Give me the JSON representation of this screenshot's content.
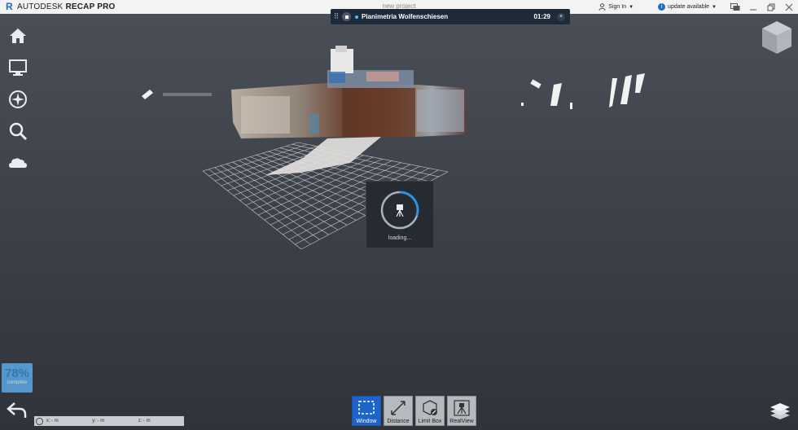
{
  "app": {
    "logo_letter": "R",
    "brand": "AUTODESK",
    "product": "RECAP PRO",
    "project_label": "new project"
  },
  "titlebar": {
    "sign_in": "Sign In",
    "update": "update available",
    "icons": [
      "user-icon",
      "info-icon",
      "chat-icon",
      "minimize-icon",
      "restore-icon",
      "close-icon"
    ]
  },
  "banner": {
    "name": "Planimetria Wolfenschiesen",
    "time": "01:29",
    "close": "×"
  },
  "left_toolbar": {
    "items": [
      "home-icon",
      "monitor-icon",
      "compass-icon",
      "search-icon",
      "cloud-icon"
    ]
  },
  "loading": {
    "text": "loading...",
    "spinner_fraction": 0.3
  },
  "progress": {
    "percent_text": "78%",
    "label": "complete",
    "value": 0.78
  },
  "coords": {
    "x": "x: -  m",
    "y": "y: -  m",
    "z": "z: -  m"
  },
  "bottom_tools": [
    {
      "label": "Window",
      "icon": "window-select-icon",
      "active": true
    },
    {
      "label": "Distance",
      "icon": "distance-icon",
      "active": false
    },
    {
      "label": "Limit Box",
      "icon": "limit-box-icon",
      "active": false
    },
    {
      "label": "RealView",
      "icon": "realview-icon",
      "active": false
    }
  ],
  "colors": {
    "accent": "#1e63c9",
    "progress": "#5aa9e6",
    "banner_bg": "#1c2a3a"
  }
}
